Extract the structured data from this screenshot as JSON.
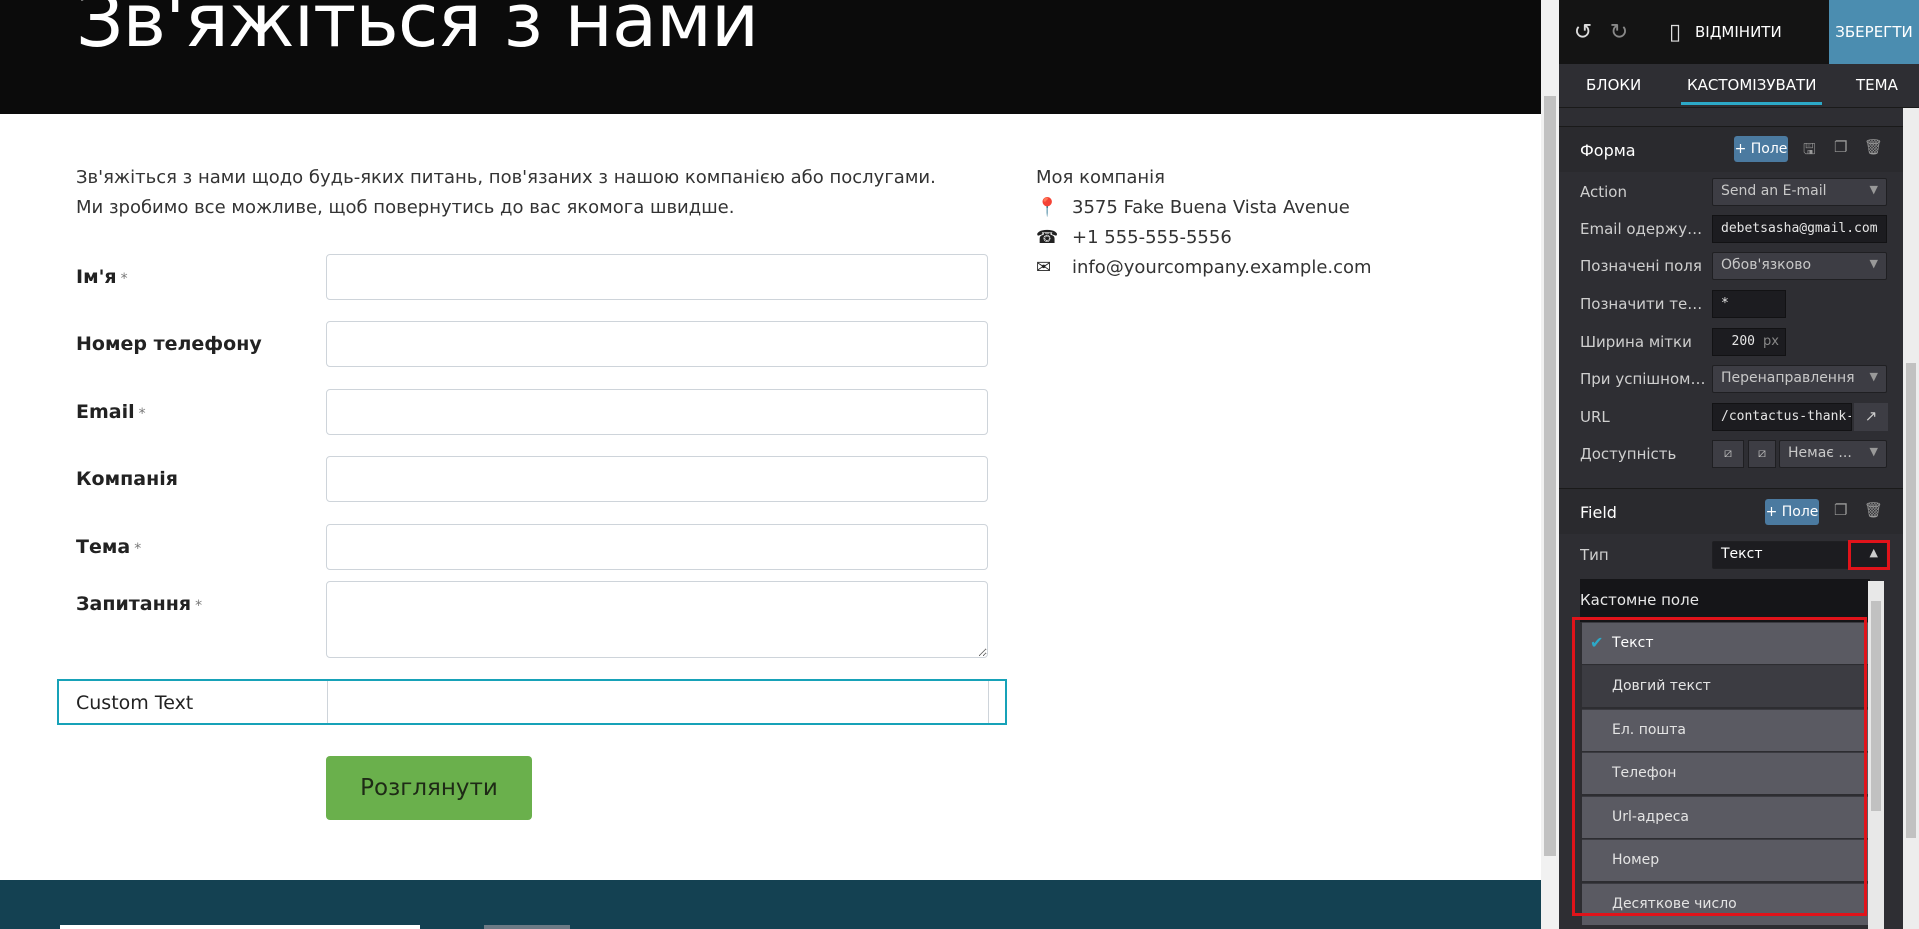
{
  "page": {
    "title": "Зв'яжіться з нами",
    "intro_line1": "Зв'яжіться з нами щодо будь-яких питань, пов'язаних з нашою компанією або послугами.",
    "intro_line2": "Ми зробимо все можливе, щоб повернутись до вас якомога швидше.",
    "company_name": "Моя компанія",
    "address": "3575 Fake Buena Vista Avenue",
    "phone": "+1 555-555-5556",
    "email": "info@yourcompany.example.com",
    "address_icon": "map-marker-icon",
    "phone_icon": "phone-icon",
    "email_icon": "envelope-icon",
    "fields": [
      {
        "label": "Ім'я",
        "required": "*"
      },
      {
        "label": "Номер телефону",
        "required": ""
      },
      {
        "label": "Email",
        "required": "*"
      },
      {
        "label": "Компанія",
        "required": ""
      },
      {
        "label": "Тема",
        "required": "*"
      },
      {
        "label": "Запитання",
        "required": "*"
      }
    ],
    "custom_field_label": "Custom Text",
    "submit_label": "Розглянути",
    "accent_color": "#6ab04c",
    "footer_color": "#144152"
  },
  "panel": {
    "toolbar": {
      "undo_icon": "undo-icon",
      "redo_icon": "redo-icon",
      "mobile_icon": "mobile-icon",
      "discard_label": "ВІДМІНИТИ",
      "save_label": "ЗБЕРЕГТИ"
    },
    "tabs": [
      "БЛОКИ",
      "КАСТОМІЗУВАТИ",
      "ТЕМА"
    ],
    "form_section": {
      "title": "Форма",
      "add_field_label": "+ Поле",
      "rows": {
        "action_label": "Action",
        "action_value": "Send an E-mail",
        "email_label": "Email одержувача",
        "email_value": "debetsasha@gmail.com",
        "marked_label": "Позначені поля",
        "marked_value": "Обов'язково",
        "mark_text_label": "Позначити текст",
        "mark_text_value": "*",
        "label_width_label": "Ширина мітки",
        "label_width_value": "200",
        "label_width_unit": "px",
        "on_success_label": "При успішному ...",
        "on_success_value": "Перенаправлення",
        "url_label": "URL",
        "url_value": "/contactus-thank-you",
        "visibility_label": "Доступність",
        "visibility_value": "Немає ..."
      }
    },
    "field_section": {
      "title": "Field",
      "add_field_label": "+ Поле",
      "type_label": "Тип",
      "type_value": "Текст",
      "dropdown_header": "Кастомне поле",
      "options": [
        "Текст",
        "Довгий текст",
        "Ел. пошта",
        "Телефон",
        "Url-адреса",
        "Номер",
        "Десяткове число"
      ],
      "selected_index": 0
    }
  }
}
